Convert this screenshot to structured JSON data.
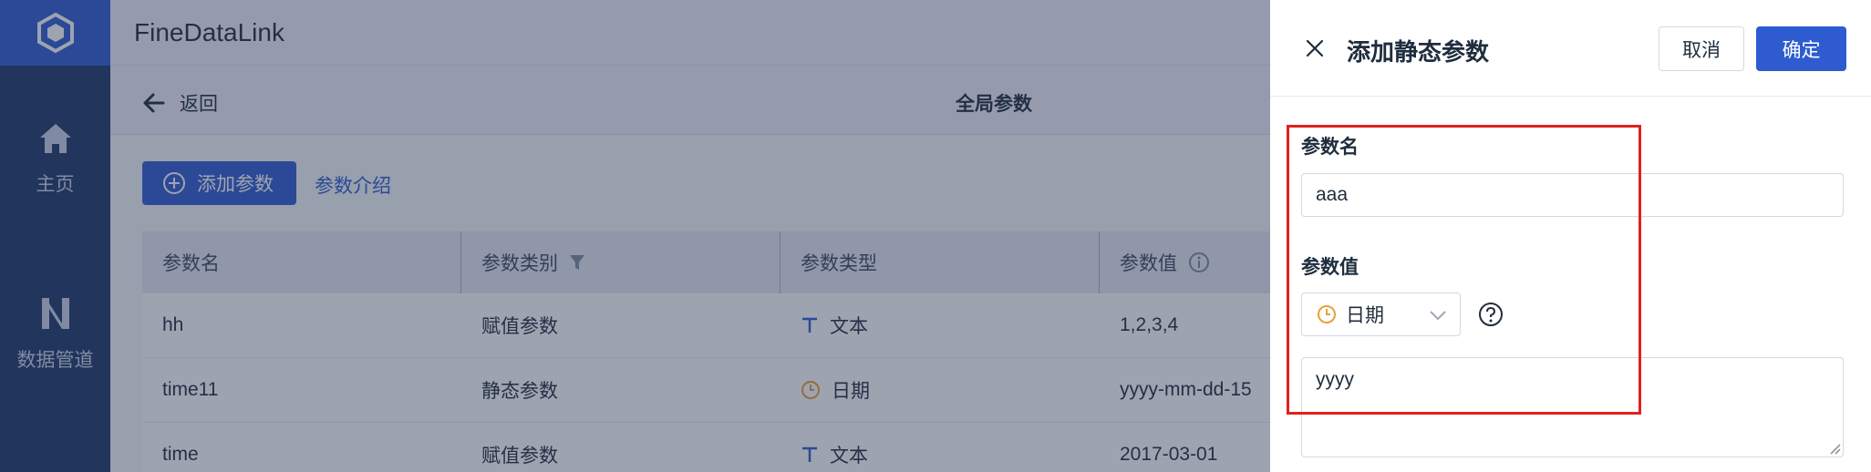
{
  "app": {
    "brand": "FineDataLink"
  },
  "sidebar": {
    "items": [
      {
        "label": "主页",
        "icon": "home-icon"
      },
      {
        "label": "数据管道",
        "icon": "pipeline-icon"
      }
    ]
  },
  "subbar": {
    "back_label": "返回",
    "title": "全局参数"
  },
  "toolbar": {
    "add_label": "添加参数",
    "intro_link": "参数介绍"
  },
  "table": {
    "columns": [
      "参数名",
      "参数类别",
      "参数类型",
      "参数值"
    ],
    "rows": [
      {
        "name": "hh",
        "category": "赋值参数",
        "type": "文本",
        "type_icon": "text-type-icon",
        "value": "1,2,3,4"
      },
      {
        "name": "time11",
        "category": "静态参数",
        "type": "日期",
        "type_icon": "clock-icon",
        "value": "yyyy-mm-dd-15"
      },
      {
        "name": "time",
        "category": "赋值参数",
        "type": "文本",
        "type_icon": "text-type-icon",
        "value": "2017-03-01"
      }
    ]
  },
  "drawer": {
    "title": "添加静态参数",
    "cancel_label": "取消",
    "ok_label": "确定",
    "name_label": "参数名",
    "name_value": "aaa",
    "value_label": "参数值",
    "type_selected": "日期",
    "value_text": "yyyy"
  },
  "colors": {
    "primary": "#2e5cd0",
    "sidebar": "#1d3868",
    "highlight": "#e02020",
    "date_icon": "#e8a13a"
  }
}
